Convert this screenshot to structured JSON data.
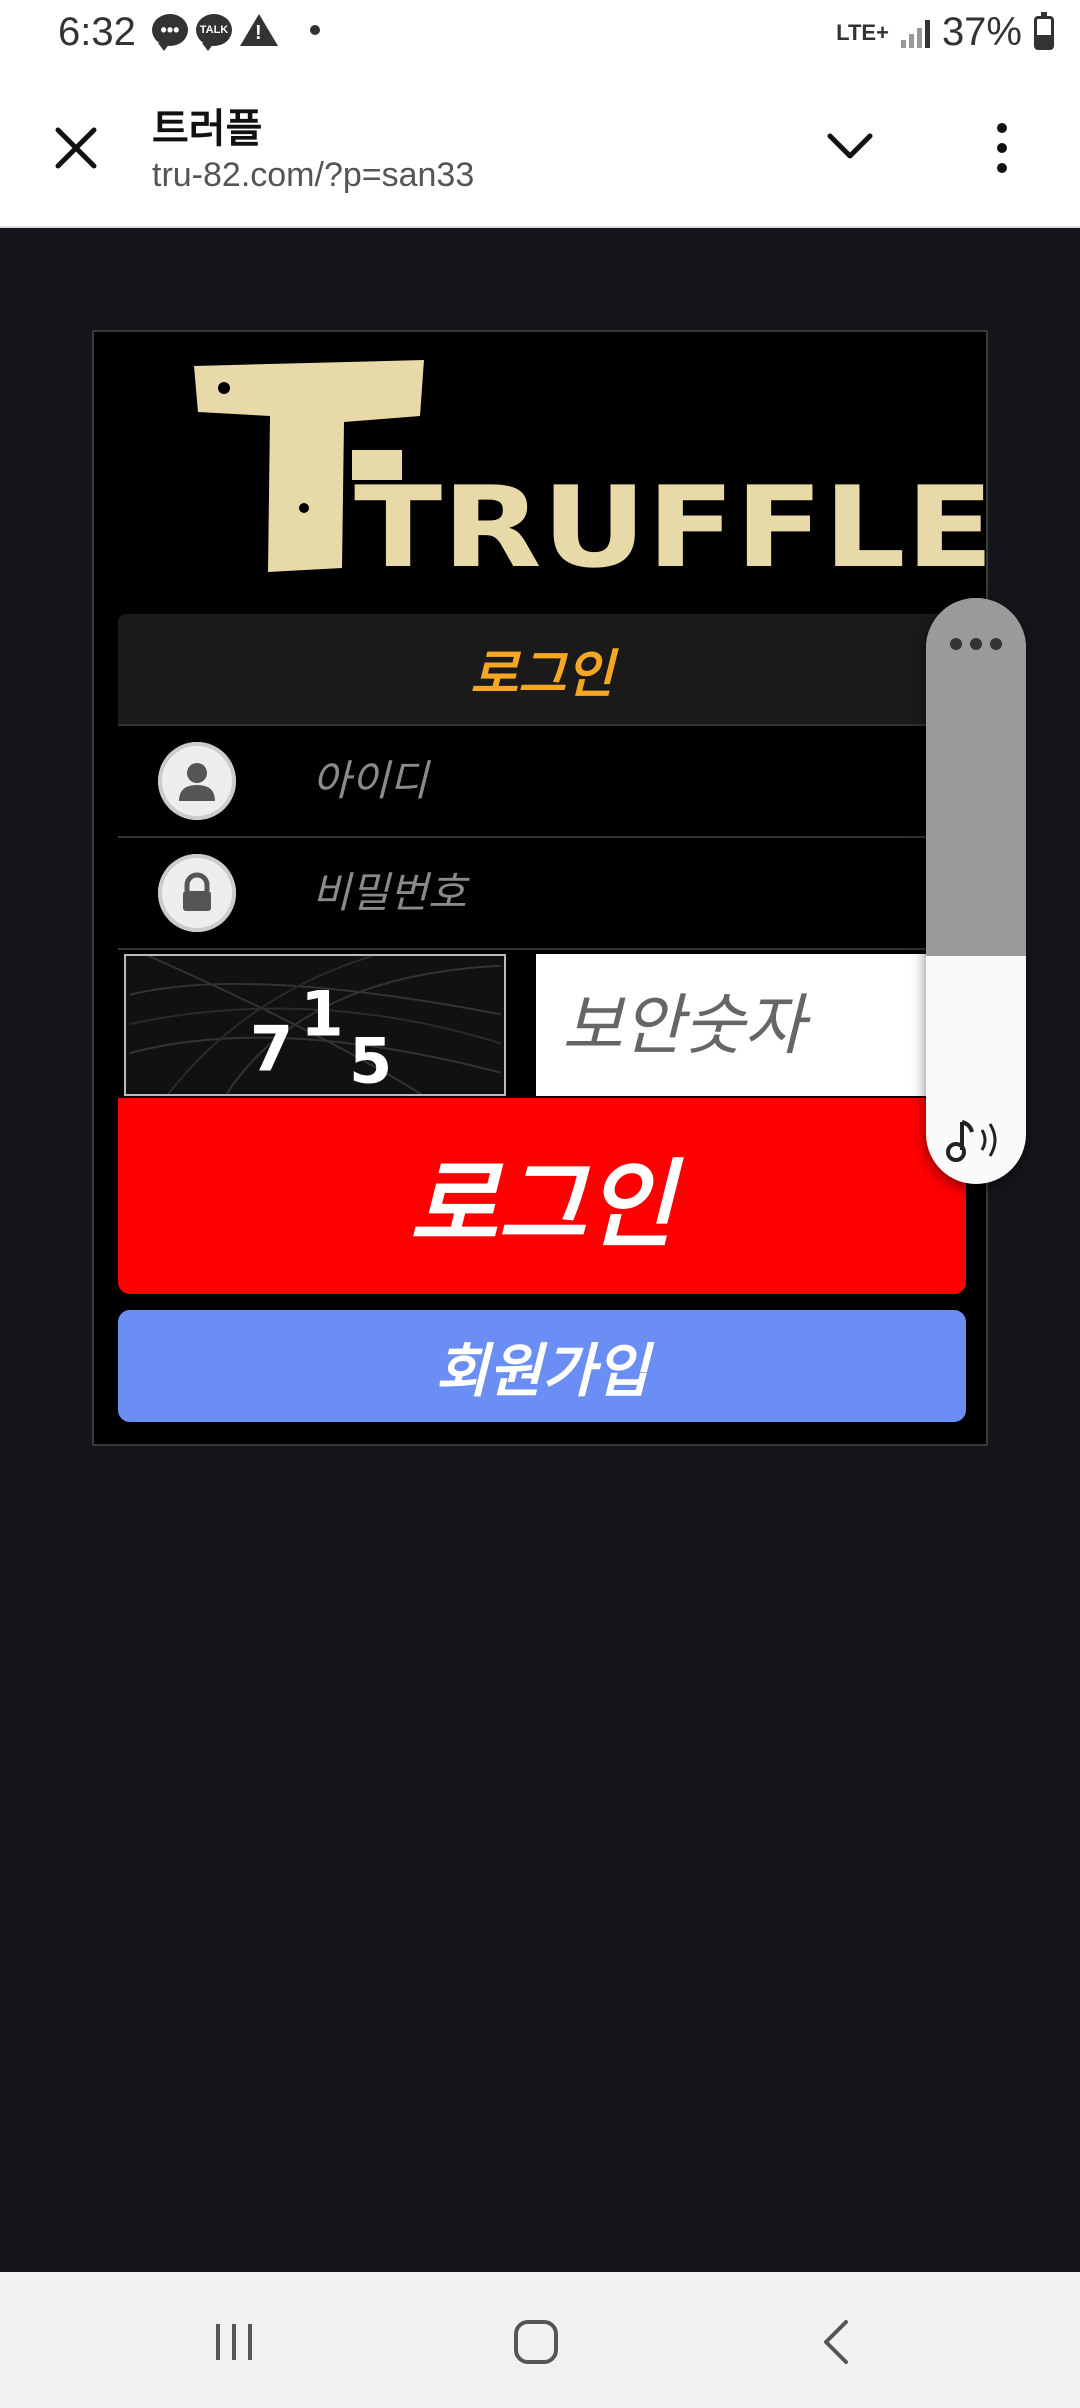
{
  "status_bar": {
    "time": "6:32",
    "talk_label": "TALK",
    "network": "LTE+",
    "battery": "37%"
  },
  "browser": {
    "title": "트러플",
    "url": "tru-82.com/?p=san33"
  },
  "login": {
    "logo_text": "TRUFFLE",
    "header": "로그인",
    "id_placeholder": "아이디",
    "password_placeholder": "비밀번호",
    "captcha_digits": [
      "7",
      "1",
      "5"
    ],
    "security_placeholder": "보안숫자",
    "login_button": "로그인",
    "signup_button": "회원가입"
  },
  "volume": {
    "level": 0.6
  },
  "colors": {
    "accent_orange": "#f5a623",
    "login_red": "#ff0000",
    "signup_blue": "#6b8ef5",
    "background": "#15161b"
  },
  "icons": [
    "close-icon",
    "chevron-down-icon",
    "more-vert-icon",
    "user-icon",
    "lock-icon",
    "music-volume-icon",
    "recent-apps-icon",
    "home-icon",
    "back-icon"
  ]
}
